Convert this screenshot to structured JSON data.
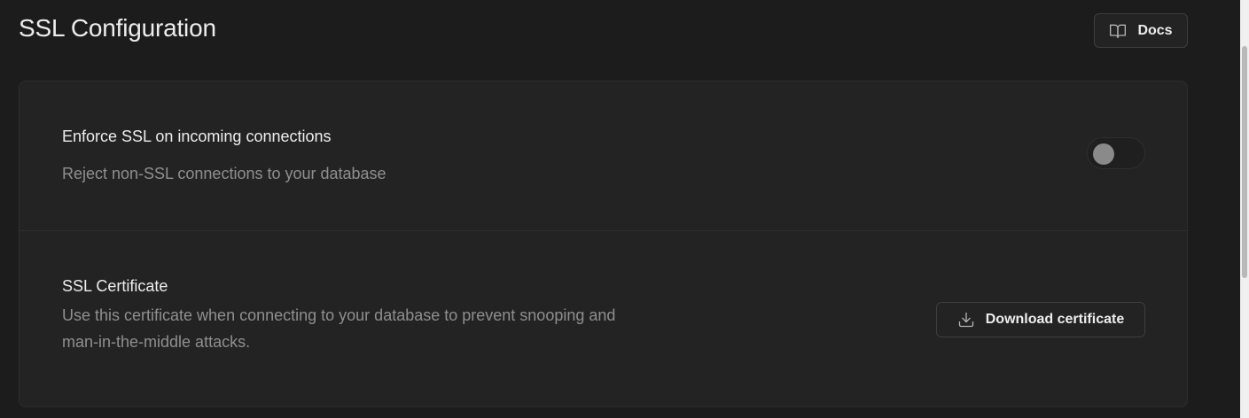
{
  "header": {
    "title": "SSL Configuration",
    "docs_label": "Docs",
    "docs_icon": "book-open-icon"
  },
  "settings": [
    {
      "title": "Enforce SSL on incoming connections",
      "description": "Reject non-SSL connections to your database",
      "control": "toggle",
      "enabled": false
    },
    {
      "title": "SSL Certificate",
      "description": "Use this certificate when connecting to your database to prevent snooping and man-in-the-middle attacks.",
      "control": "button",
      "button_label": "Download certificate",
      "button_icon": "download-icon"
    }
  ],
  "colors": {
    "background": "#1c1c1c",
    "panel": "#232323",
    "border": "#2e2e2e",
    "text_primary": "#ededed",
    "text_secondary": "#8f8f8f"
  }
}
